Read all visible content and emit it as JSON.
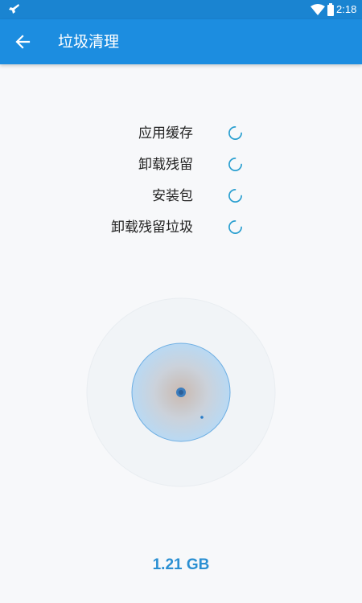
{
  "status_bar": {
    "time": "2:18",
    "left_icon": "notification-icon",
    "wifi_icon": "wifi-icon",
    "battery_icon": "battery-icon"
  },
  "app_bar": {
    "back_icon": "arrow-back-icon",
    "title": "垃圾清理"
  },
  "scan_items": [
    {
      "label": "应用缓存",
      "status_icon": "loading-spinner-icon"
    },
    {
      "label": "卸载残留",
      "status_icon": "loading-spinner-icon"
    },
    {
      "label": "安装包",
      "status_icon": "loading-spinner-icon"
    },
    {
      "label": "卸载残留垃圾",
      "status_icon": "loading-spinner-icon"
    }
  ],
  "radar": {
    "icon": "radar-scan-icon"
  },
  "total_size": "1.21 GB",
  "colors": {
    "primary": "#1c8de0",
    "status_bar": "#1a84d1",
    "accent": "#2a9fd0",
    "background": "#f7f8fa",
    "text": "#222222"
  }
}
